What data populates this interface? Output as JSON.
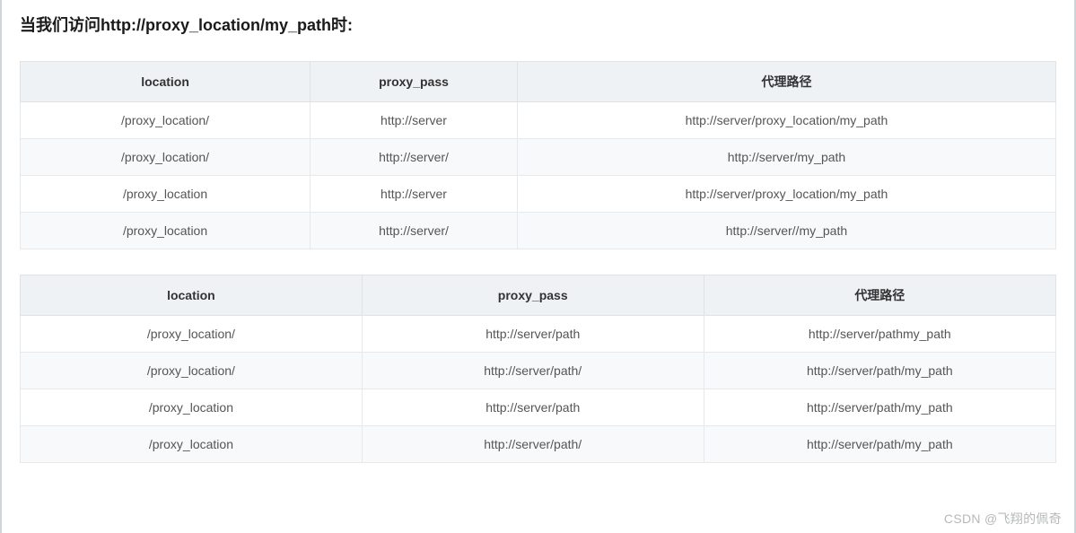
{
  "heading": "当我们访问http://proxy_location/my_path时:",
  "headers": {
    "col1": "location",
    "col2": "proxy_pass",
    "col3": "代理路径"
  },
  "table1": {
    "rows": [
      {
        "c1": "/proxy_location/",
        "c2": "http://server",
        "c3": "http://server/proxy_location/my_path"
      },
      {
        "c1": "/proxy_location/",
        "c2": "http://server/",
        "c3": "http://server/my_path"
      },
      {
        "c1": "/proxy_location",
        "c2": "http://server",
        "c3": "http://server/proxy_location/my_path"
      },
      {
        "c1": "/proxy_location",
        "c2": "http://server/",
        "c3": "http://server//my_path"
      }
    ]
  },
  "table2": {
    "rows": [
      {
        "c1": "/proxy_location/",
        "c2": "http://server/path",
        "c3": "http://server/pathmy_path"
      },
      {
        "c1": "/proxy_location/",
        "c2": "http://server/path/",
        "c3": "http://server/path/my_path"
      },
      {
        "c1": "/proxy_location",
        "c2": "http://server/path",
        "c3": "http://server/path/my_path"
      },
      {
        "c1": "/proxy_location",
        "c2": "http://server/path/",
        "c3": "http://server/path/my_path"
      }
    ]
  },
  "watermark": "CSDN @飞翔的佩奇"
}
